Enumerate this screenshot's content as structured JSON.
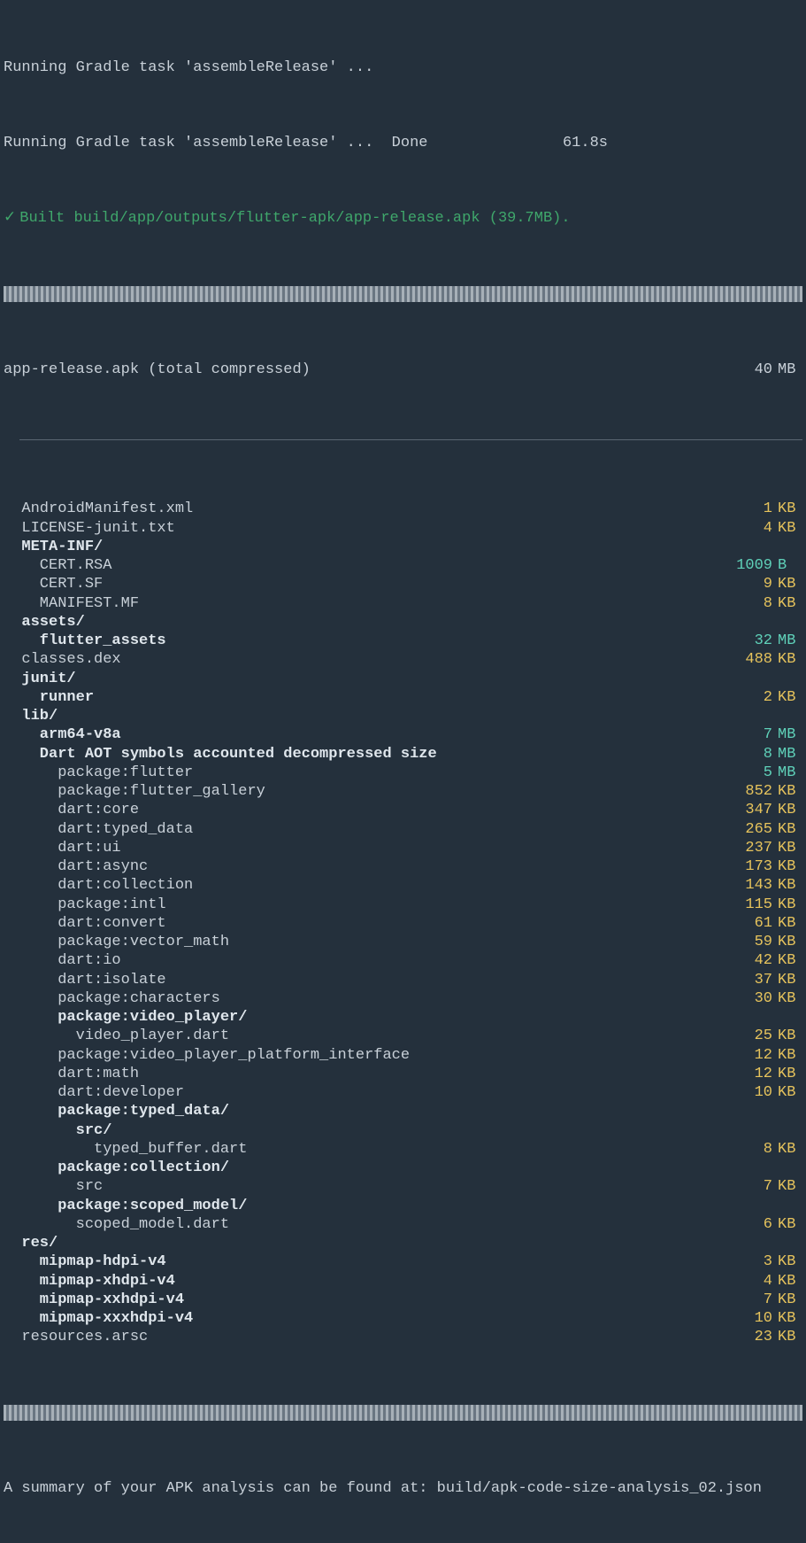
{
  "header": {
    "line1": "Running Gradle task 'assembleRelease' ...",
    "line2_left": "Running Gradle task 'assembleRelease' ...  Done",
    "line2_right": "61.8s",
    "check": "✓",
    "built_line": "Built build/app/outputs/flutter-apk/app-release.apk (39.7MB)."
  },
  "total_row": {
    "name": "app-release.apk (total compressed)",
    "size": "40",
    "unit": "MB"
  },
  "rows": [
    {
      "indent": 1,
      "name": "AndroidManifest.xml",
      "bold": false,
      "size": "1",
      "unit": "KB"
    },
    {
      "indent": 1,
      "name": "LICENSE-junit.txt",
      "bold": false,
      "size": "4",
      "unit": "KB"
    },
    {
      "indent": 1,
      "name": "META-INF/",
      "bold": true
    },
    {
      "indent": 2,
      "name": "CERT.RSA",
      "bold": false,
      "size": "1009",
      "unit": "B"
    },
    {
      "indent": 2,
      "name": "CERT.SF",
      "bold": false,
      "size": "9",
      "unit": "KB"
    },
    {
      "indent": 2,
      "name": "MANIFEST.MF",
      "bold": false,
      "size": "8",
      "unit": "KB"
    },
    {
      "indent": 1,
      "name": "assets/",
      "bold": true
    },
    {
      "indent": 2,
      "name": "flutter_assets",
      "bold": true,
      "size": "32",
      "unit": "MB"
    },
    {
      "indent": 1,
      "name": "classes.dex",
      "bold": false,
      "size": "488",
      "unit": "KB"
    },
    {
      "indent": 1,
      "name": "junit/",
      "bold": true
    },
    {
      "indent": 2,
      "name": "runner",
      "bold": true,
      "size": "2",
      "unit": "KB"
    },
    {
      "indent": 1,
      "name": "lib/",
      "bold": true
    },
    {
      "indent": 2,
      "name": "arm64-v8a",
      "bold": true,
      "size": "7",
      "unit": "MB"
    },
    {
      "indent": 2,
      "name": "Dart AOT symbols accounted decompressed size",
      "bold": true,
      "size": "8",
      "unit": "MB"
    },
    {
      "indent": 3,
      "name": "package:flutter",
      "bold": false,
      "size": "5",
      "unit": "MB"
    },
    {
      "indent": 3,
      "name": "package:flutter_gallery",
      "bold": false,
      "size": "852",
      "unit": "KB"
    },
    {
      "indent": 3,
      "name": "dart:core",
      "bold": false,
      "size": "347",
      "unit": "KB"
    },
    {
      "indent": 3,
      "name": "dart:typed_data",
      "bold": false,
      "size": "265",
      "unit": "KB"
    },
    {
      "indent": 3,
      "name": "dart:ui",
      "bold": false,
      "size": "237",
      "unit": "KB"
    },
    {
      "indent": 3,
      "name": "dart:async",
      "bold": false,
      "size": "173",
      "unit": "KB"
    },
    {
      "indent": 3,
      "name": "dart:collection",
      "bold": false,
      "size": "143",
      "unit": "KB"
    },
    {
      "indent": 3,
      "name": "package:intl",
      "bold": false,
      "size": "115",
      "unit": "KB"
    },
    {
      "indent": 3,
      "name": "dart:convert",
      "bold": false,
      "size": "61",
      "unit": "KB"
    },
    {
      "indent": 3,
      "name": "package:vector_math",
      "bold": false,
      "size": "59",
      "unit": "KB"
    },
    {
      "indent": 3,
      "name": "dart:io",
      "bold": false,
      "size": "42",
      "unit": "KB"
    },
    {
      "indent": 3,
      "name": "dart:isolate",
      "bold": false,
      "size": "37",
      "unit": "KB"
    },
    {
      "indent": 3,
      "name": "package:characters",
      "bold": false,
      "size": "30",
      "unit": "KB"
    },
    {
      "indent": 3,
      "name": "package:video_player/",
      "bold": true
    },
    {
      "indent": 4,
      "name": "video_player.dart",
      "bold": false,
      "size": "25",
      "unit": "KB"
    },
    {
      "indent": 3,
      "name": "package:video_player_platform_interface",
      "bold": false,
      "size": "12",
      "unit": "KB"
    },
    {
      "indent": 3,
      "name": "dart:math",
      "bold": false,
      "size": "12",
      "unit": "KB"
    },
    {
      "indent": 3,
      "name": "dart:developer",
      "bold": false,
      "size": "10",
      "unit": "KB"
    },
    {
      "indent": 3,
      "name": "package:typed_data/",
      "bold": true
    },
    {
      "indent": 4,
      "name": "src/",
      "bold": true
    },
    {
      "indent": 5,
      "name": "typed_buffer.dart",
      "bold": false,
      "size": "8",
      "unit": "KB"
    },
    {
      "indent": 3,
      "name": "package:collection/",
      "bold": true
    },
    {
      "indent": 4,
      "name": "src",
      "bold": false,
      "size": "7",
      "unit": "KB"
    },
    {
      "indent": 3,
      "name": "package:scoped_model/",
      "bold": true
    },
    {
      "indent": 4,
      "name": "scoped_model.dart",
      "bold": false,
      "size": "6",
      "unit": "KB"
    },
    {
      "indent": 1,
      "name": "res/",
      "bold": true
    },
    {
      "indent": 2,
      "name": "mipmap-hdpi-v4",
      "bold": true,
      "size": "3",
      "unit": "KB"
    },
    {
      "indent": 2,
      "name": "mipmap-xhdpi-v4",
      "bold": true,
      "size": "4",
      "unit": "KB"
    },
    {
      "indent": 2,
      "name": "mipmap-xxhdpi-v4",
      "bold": true,
      "size": "7",
      "unit": "KB"
    },
    {
      "indent": 2,
      "name": "mipmap-xxxhdpi-v4",
      "bold": true,
      "size": "10",
      "unit": "KB"
    },
    {
      "indent": 1,
      "name": "resources.arsc",
      "bold": false,
      "size": "23",
      "unit": "KB"
    }
  ],
  "footer": "A summary of your APK analysis can be found at: build/apk-code-size-analysis_02.json"
}
